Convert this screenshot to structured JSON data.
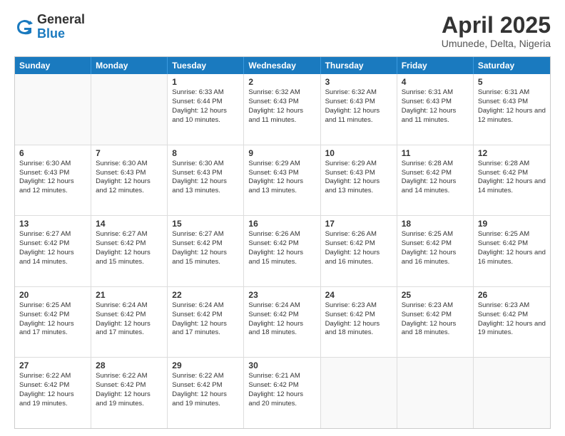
{
  "header": {
    "logo_general": "General",
    "logo_blue": "Blue",
    "month_year": "April 2025",
    "location": "Umunede, Delta, Nigeria"
  },
  "days_of_week": [
    "Sunday",
    "Monday",
    "Tuesday",
    "Wednesday",
    "Thursday",
    "Friday",
    "Saturday"
  ],
  "weeks": [
    [
      {
        "day": "",
        "empty": true
      },
      {
        "day": "",
        "empty": true
      },
      {
        "day": "1",
        "sunrise": "Sunrise: 6:33 AM",
        "sunset": "Sunset: 6:44 PM",
        "daylight": "Daylight: 12 hours and 10 minutes."
      },
      {
        "day": "2",
        "sunrise": "Sunrise: 6:32 AM",
        "sunset": "Sunset: 6:43 PM",
        "daylight": "Daylight: 12 hours and 11 minutes."
      },
      {
        "day": "3",
        "sunrise": "Sunrise: 6:32 AM",
        "sunset": "Sunset: 6:43 PM",
        "daylight": "Daylight: 12 hours and 11 minutes."
      },
      {
        "day": "4",
        "sunrise": "Sunrise: 6:31 AM",
        "sunset": "Sunset: 6:43 PM",
        "daylight": "Daylight: 12 hours and 11 minutes."
      },
      {
        "day": "5",
        "sunrise": "Sunrise: 6:31 AM",
        "sunset": "Sunset: 6:43 PM",
        "daylight": "Daylight: 12 hours and 12 minutes."
      }
    ],
    [
      {
        "day": "6",
        "sunrise": "Sunrise: 6:30 AM",
        "sunset": "Sunset: 6:43 PM",
        "daylight": "Daylight: 12 hours and 12 minutes."
      },
      {
        "day": "7",
        "sunrise": "Sunrise: 6:30 AM",
        "sunset": "Sunset: 6:43 PM",
        "daylight": "Daylight: 12 hours and 12 minutes."
      },
      {
        "day": "8",
        "sunrise": "Sunrise: 6:30 AM",
        "sunset": "Sunset: 6:43 PM",
        "daylight": "Daylight: 12 hours and 13 minutes."
      },
      {
        "day": "9",
        "sunrise": "Sunrise: 6:29 AM",
        "sunset": "Sunset: 6:43 PM",
        "daylight": "Daylight: 12 hours and 13 minutes."
      },
      {
        "day": "10",
        "sunrise": "Sunrise: 6:29 AM",
        "sunset": "Sunset: 6:43 PM",
        "daylight": "Daylight: 12 hours and 13 minutes."
      },
      {
        "day": "11",
        "sunrise": "Sunrise: 6:28 AM",
        "sunset": "Sunset: 6:42 PM",
        "daylight": "Daylight: 12 hours and 14 minutes."
      },
      {
        "day": "12",
        "sunrise": "Sunrise: 6:28 AM",
        "sunset": "Sunset: 6:42 PM",
        "daylight": "Daylight: 12 hours and 14 minutes."
      }
    ],
    [
      {
        "day": "13",
        "sunrise": "Sunrise: 6:27 AM",
        "sunset": "Sunset: 6:42 PM",
        "daylight": "Daylight: 12 hours and 14 minutes."
      },
      {
        "day": "14",
        "sunrise": "Sunrise: 6:27 AM",
        "sunset": "Sunset: 6:42 PM",
        "daylight": "Daylight: 12 hours and 15 minutes."
      },
      {
        "day": "15",
        "sunrise": "Sunrise: 6:27 AM",
        "sunset": "Sunset: 6:42 PM",
        "daylight": "Daylight: 12 hours and 15 minutes."
      },
      {
        "day": "16",
        "sunrise": "Sunrise: 6:26 AM",
        "sunset": "Sunset: 6:42 PM",
        "daylight": "Daylight: 12 hours and 15 minutes."
      },
      {
        "day": "17",
        "sunrise": "Sunrise: 6:26 AM",
        "sunset": "Sunset: 6:42 PM",
        "daylight": "Daylight: 12 hours and 16 minutes."
      },
      {
        "day": "18",
        "sunrise": "Sunrise: 6:25 AM",
        "sunset": "Sunset: 6:42 PM",
        "daylight": "Daylight: 12 hours and 16 minutes."
      },
      {
        "day": "19",
        "sunrise": "Sunrise: 6:25 AM",
        "sunset": "Sunset: 6:42 PM",
        "daylight": "Daylight: 12 hours and 16 minutes."
      }
    ],
    [
      {
        "day": "20",
        "sunrise": "Sunrise: 6:25 AM",
        "sunset": "Sunset: 6:42 PM",
        "daylight": "Daylight: 12 hours and 17 minutes."
      },
      {
        "day": "21",
        "sunrise": "Sunrise: 6:24 AM",
        "sunset": "Sunset: 6:42 PM",
        "daylight": "Daylight: 12 hours and 17 minutes."
      },
      {
        "day": "22",
        "sunrise": "Sunrise: 6:24 AM",
        "sunset": "Sunset: 6:42 PM",
        "daylight": "Daylight: 12 hours and 17 minutes."
      },
      {
        "day": "23",
        "sunrise": "Sunrise: 6:24 AM",
        "sunset": "Sunset: 6:42 PM",
        "daylight": "Daylight: 12 hours and 18 minutes."
      },
      {
        "day": "24",
        "sunrise": "Sunrise: 6:23 AM",
        "sunset": "Sunset: 6:42 PM",
        "daylight": "Daylight: 12 hours and 18 minutes."
      },
      {
        "day": "25",
        "sunrise": "Sunrise: 6:23 AM",
        "sunset": "Sunset: 6:42 PM",
        "daylight": "Daylight: 12 hours and 18 minutes."
      },
      {
        "day": "26",
        "sunrise": "Sunrise: 6:23 AM",
        "sunset": "Sunset: 6:42 PM",
        "daylight": "Daylight: 12 hours and 19 minutes."
      }
    ],
    [
      {
        "day": "27",
        "sunrise": "Sunrise: 6:22 AM",
        "sunset": "Sunset: 6:42 PM",
        "daylight": "Daylight: 12 hours and 19 minutes."
      },
      {
        "day": "28",
        "sunrise": "Sunrise: 6:22 AM",
        "sunset": "Sunset: 6:42 PM",
        "daylight": "Daylight: 12 hours and 19 minutes."
      },
      {
        "day": "29",
        "sunrise": "Sunrise: 6:22 AM",
        "sunset": "Sunset: 6:42 PM",
        "daylight": "Daylight: 12 hours and 19 minutes."
      },
      {
        "day": "30",
        "sunrise": "Sunrise: 6:21 AM",
        "sunset": "Sunset: 6:42 PM",
        "daylight": "Daylight: 12 hours and 20 minutes."
      },
      {
        "day": "",
        "empty": true
      },
      {
        "day": "",
        "empty": true
      },
      {
        "day": "",
        "empty": true
      }
    ]
  ]
}
